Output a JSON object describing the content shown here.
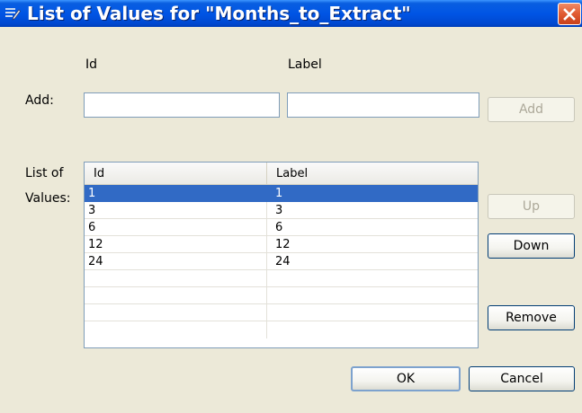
{
  "window": {
    "title": "List of Values for \"Months_to_Extract\""
  },
  "add_section": {
    "col_id_label": "Id",
    "col_label_label": "Label",
    "add_label": "Add:",
    "id_value": "",
    "label_value": "",
    "add_button": "Add"
  },
  "list_section": {
    "label_line1": "List of",
    "label_line2": "Values:",
    "headers": [
      "Id",
      "Label"
    ],
    "rows": [
      {
        "id": "1",
        "label": "1",
        "selected": true
      },
      {
        "id": "3",
        "label": "3",
        "selected": false
      },
      {
        "id": "6",
        "label": "6",
        "selected": false
      },
      {
        "id": "12",
        "label": "12",
        "selected": false
      },
      {
        "id": "24",
        "label": "24",
        "selected": false
      }
    ]
  },
  "buttons": {
    "up": "Up",
    "down": "Down",
    "remove": "Remove",
    "ok": "OK",
    "cancel": "Cancel"
  },
  "colors": {
    "titlebar": "#0055e5",
    "selection": "#316ac5",
    "close": "#e05a32"
  },
  "icons": {
    "app": "list-edit-icon",
    "close": "close-icon"
  }
}
